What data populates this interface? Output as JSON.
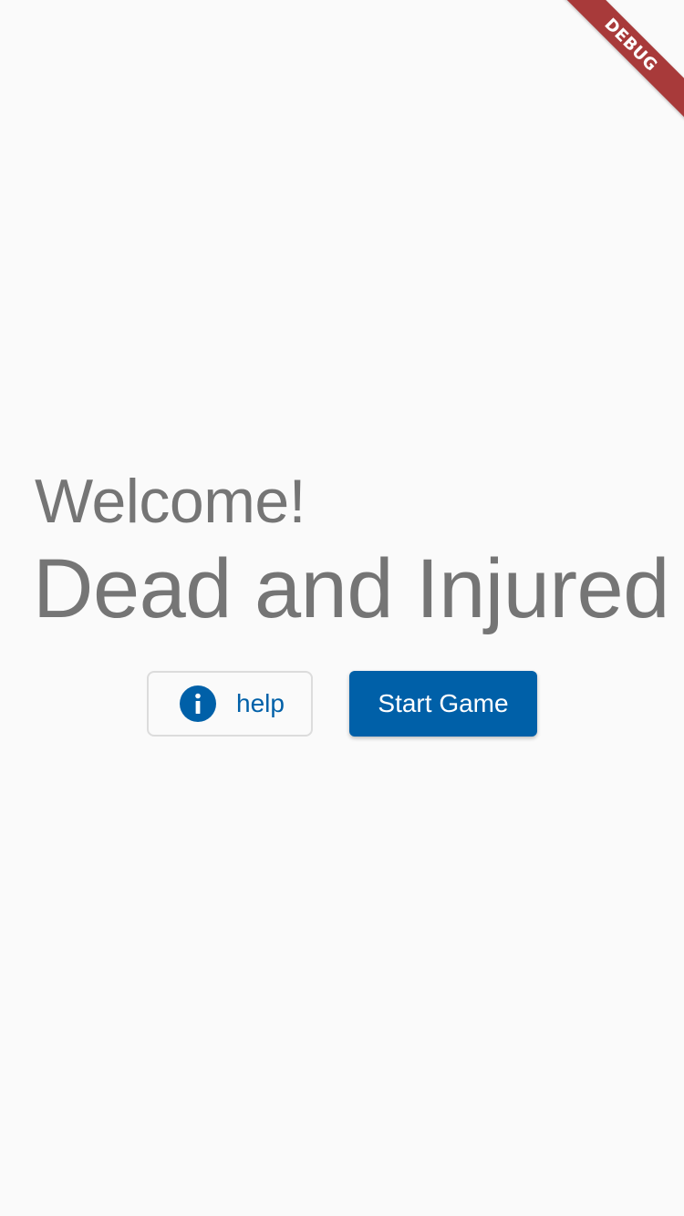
{
  "debug_banner": {
    "label": "DEBUG"
  },
  "main": {
    "welcome": "Welcome!",
    "title": "Dead and Injured"
  },
  "actions": {
    "help_label": "help",
    "help_icon": "info-icon",
    "start_label": "Start Game"
  },
  "colors": {
    "primary": "#0060a8",
    "text_gray": "#757575",
    "background": "#fafafa",
    "debug_banner": "#a83a3a"
  }
}
